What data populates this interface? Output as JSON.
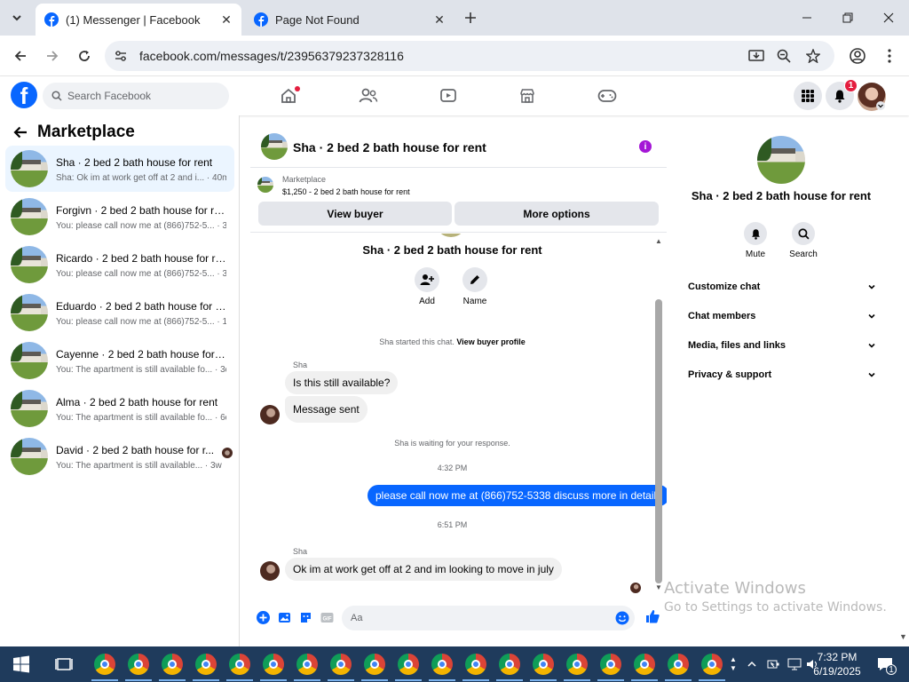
{
  "browser": {
    "tabs": [
      {
        "title": "(1) Messenger | Facebook",
        "active": true
      },
      {
        "title": "Page Not Found",
        "active": false
      }
    ],
    "url": "facebook.com/messages/t/23956379237328116"
  },
  "fb_header": {
    "search_placeholder": "Search Facebook",
    "notification_count": "1"
  },
  "sidebar": {
    "title": "Marketplace",
    "conversations": [
      {
        "name": "Sha · 2 bed 2 bath house for rent",
        "preview": "Sha: Ok im at work get off at 2 and i... · 40m",
        "selected": true
      },
      {
        "name": "Forgivn · 2 bed 2 bath house for re...",
        "preview": "You: please call now me at (866)752-5... · 3h"
      },
      {
        "name": "Ricardo · 2 bed 2 bath house for re...",
        "preview": "You: please call now me at (866)752-5... · 3h"
      },
      {
        "name": "Eduardo · 2 bed 2 bath house for r...",
        "preview": "You: please call now me at (866)752-5... · 1d"
      },
      {
        "name": "Cayenne · 2 bed 2 bath house for r...",
        "preview": "You: The apartment is still available fo... · 3d"
      },
      {
        "name": "Alma · 2 bed 2 bath house for rent",
        "preview": "You: The apartment is still available fo... · 6d"
      },
      {
        "name": "David · 2 bed 2 bath house for r...",
        "preview": "You: The apartment is still available... · 3w"
      }
    ]
  },
  "chat": {
    "title": "Sha · 2 bed 2 bath house for rent",
    "listing_label": "Marketplace",
    "listing_price": "$1,250 - 2 bed 2 bath house for rent",
    "view_buyer": "View buyer",
    "more_options": "More options",
    "intro_title": "Sha · 2 bed 2 bath house for rent",
    "add_label": "Add",
    "name_label": "Name",
    "started_text": "Sha started this chat.",
    "view_profile": "View buyer profile",
    "sender1": "Sha",
    "msg1": "Is this still available?",
    "msg2": "Message sent",
    "waiting": "Sha is waiting for your response.",
    "time1": "4:32 PM",
    "my_msg": "please call now me at (866)752-5338 discuss more in details",
    "time2": "6:51 PM",
    "sender2": "Sha",
    "msg3": "Ok im at work get off at 2 and im looking to move in july",
    "composer_placeholder": "Aa"
  },
  "details": {
    "title": "Sha · 2 bed 2 bath house for rent",
    "mute": "Mute",
    "search": "Search",
    "sections": [
      "Customize chat",
      "Chat members",
      "Media, files and links",
      "Privacy & support"
    ]
  },
  "watermark": {
    "line1": "Activate Windows",
    "line2": "Go to Settings to activate Windows."
  },
  "taskbar": {
    "time": "7:32 PM",
    "date": "6/19/2025",
    "notif_count": "1",
    "chrome_count": 19
  },
  "colors": {
    "fb_blue": "#0866ff",
    "selected_bg": "#ebf5ff",
    "taskbar": "#1f3b5c"
  }
}
